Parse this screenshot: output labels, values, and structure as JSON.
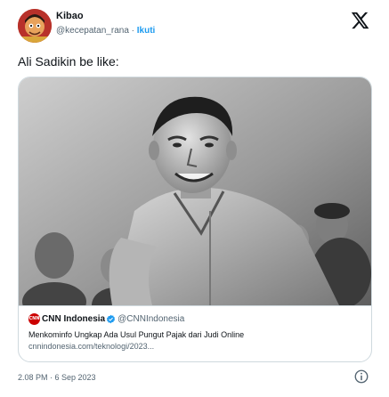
{
  "author": {
    "display_name": "Kibao",
    "handle": "@kecepatan_rana",
    "separator": "·",
    "follow_label": "Ikuti",
    "avatar_icon": "cartoon-avatar-icon"
  },
  "brand_icon": "x-logo-icon",
  "tweet": {
    "text": "Ali Sadikin be like:"
  },
  "media": {
    "photo_kind": "black-and-white-photo"
  },
  "link_card": {
    "source_logo_text": "CNN",
    "source_name": "CNN Indonesia",
    "source_handle": "@CNNIndonesia",
    "headline": "Menkominfo Ungkap Ada Usul Pungut Pajak dari Judi Online",
    "url": "cnnindonesia.com/teknologi/2023..."
  },
  "footer": {
    "timestamp": "2.08 PM · 6 Sep 2023",
    "info_icon": "info-icon"
  },
  "colors": {
    "accent": "#1d9bf0",
    "text": "#0f1419",
    "secondary_text": "#536471",
    "border": "#cfd9de",
    "cnn_red": "#cc0000"
  }
}
